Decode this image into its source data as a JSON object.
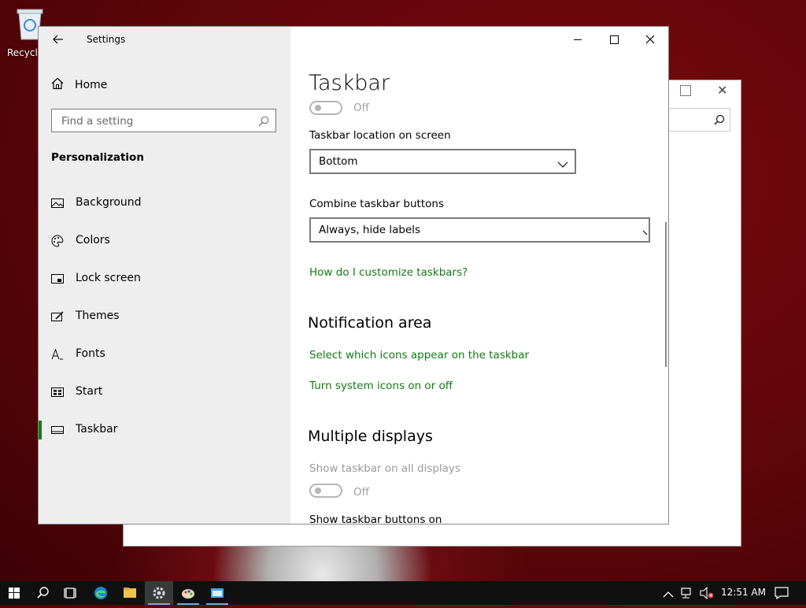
{
  "desktop": {
    "recycle_bin_label": "Recycle"
  },
  "settings_window": {
    "title": "Settings",
    "sidebar": {
      "home_label": "Home",
      "search_placeholder": "Find a setting",
      "section_title": "Personalization",
      "items": [
        {
          "label": "Background",
          "icon": "picture-icon"
        },
        {
          "label": "Colors",
          "icon": "palette-icon"
        },
        {
          "label": "Lock screen",
          "icon": "lock-screen-icon"
        },
        {
          "label": "Themes",
          "icon": "brush-icon"
        },
        {
          "label": "Fonts",
          "icon": "font-icon"
        },
        {
          "label": "Start",
          "icon": "start-menu-icon"
        },
        {
          "label": "Taskbar",
          "icon": "taskbar-icon",
          "active": true
        }
      ]
    },
    "main": {
      "page_title": "Taskbar",
      "top_toggle_state": "Off",
      "location_label": "Taskbar location on screen",
      "location_value": "Bottom",
      "combine_label": "Combine taskbar buttons",
      "combine_value": "Always, hide labels",
      "customize_link": "How do I customize taskbars?",
      "notification_heading": "Notification area",
      "select_icons_link": "Select which icons appear on the taskbar",
      "system_icons_link": "Turn system icons on or off",
      "multiple_displays_heading": "Multiple displays",
      "show_all_displays_label": "Show taskbar on all displays",
      "show_all_displays_state": "Off",
      "show_buttons_on_label": "Show taskbar buttons on"
    }
  },
  "taskbar": {
    "time": "12:51 AM"
  },
  "colors": {
    "accent": "#107c10",
    "sidebar_bg": "#eeeeee",
    "taskbar_bg": "#101010"
  }
}
